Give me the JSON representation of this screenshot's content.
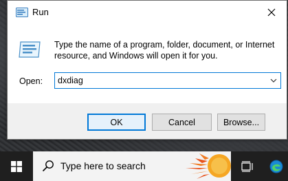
{
  "dialog": {
    "title": "Run",
    "description": "Type the name of a program, folder, document, or Internet resource, and Windows will open it for you.",
    "open_label": "Open:",
    "open_value": "dxdiag",
    "buttons": {
      "ok": "OK",
      "cancel": "Cancel",
      "browse": "Browse..."
    }
  },
  "taskbar": {
    "search_placeholder": "Type here to search"
  },
  "colors": {
    "accent": "#0078d7",
    "taskbar": "#1f1f1f",
    "dialog_bg": "#f0f0f0"
  }
}
